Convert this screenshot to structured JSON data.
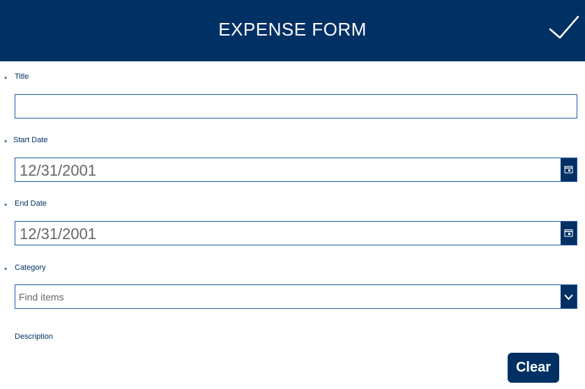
{
  "header": {
    "title": "EXPENSE FORM",
    "background_color": "#003064",
    "submit_icon": "check-icon"
  },
  "form": {
    "required_marker": "*",
    "title": {
      "label": "Title",
      "value": "",
      "required": true
    },
    "start_date": {
      "label": "Start Date",
      "value": "12/31/2001",
      "required": true,
      "icon": "calendar-icon"
    },
    "end_date": {
      "label": "End Date",
      "value": "12/31/2001",
      "required": true,
      "icon": "calendar-icon"
    },
    "category": {
      "label": "Category",
      "placeholder": "Find items",
      "required": true,
      "icon": "chevron-down-icon"
    },
    "description": {
      "label": "Description",
      "required": false
    }
  },
  "actions": {
    "clear_label": "Clear"
  },
  "colors": {
    "accent": "#003064",
    "border": "#1e5aa6",
    "value_text": "#666666"
  }
}
